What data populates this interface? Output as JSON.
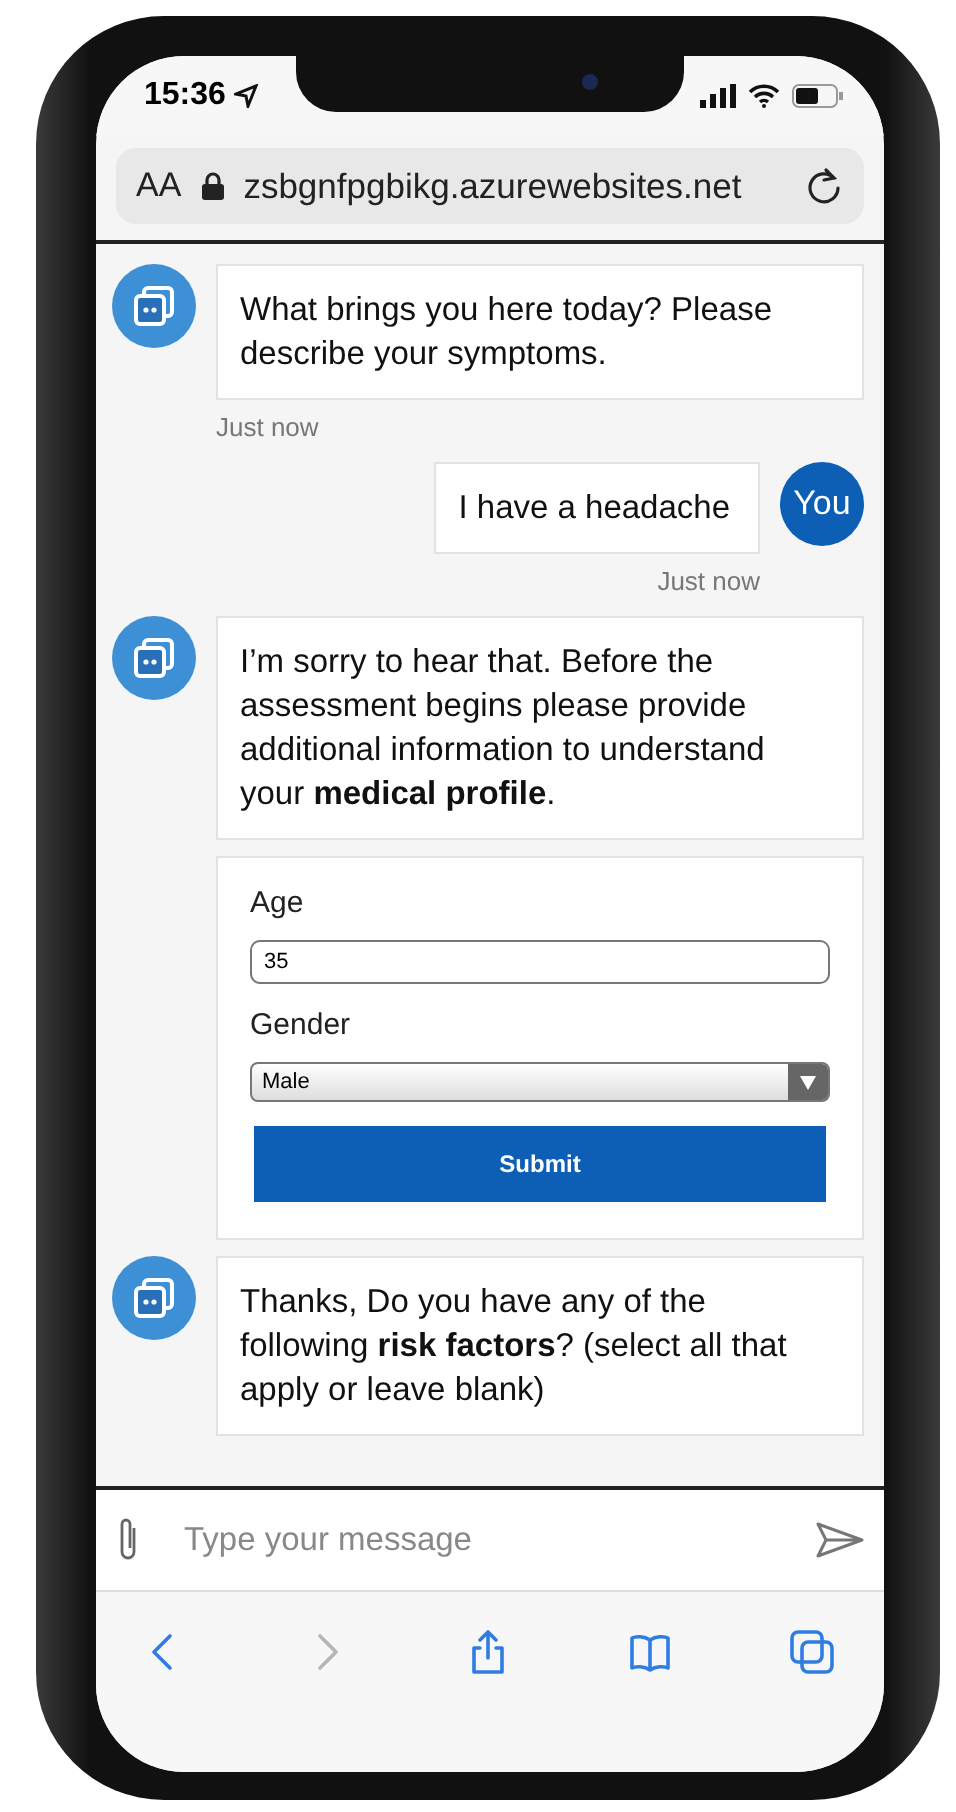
{
  "status_bar": {
    "time": "15:36"
  },
  "address_bar": {
    "text_size": "AA",
    "url": "zsbgnfpgbikg.azurewebsites.net"
  },
  "messages": [
    {
      "kind": "text",
      "from_user": false,
      "text": "What brings you here today? Please describe your symptoms.",
      "time": "Just now"
    },
    {
      "kind": "text",
      "from_user": true,
      "avatar": "You",
      "text": "I have a headache",
      "time": "Just now"
    },
    {
      "kind": "text",
      "from_user": false,
      "text": "I’m sorry to hear that. Before the assessment begins please provide additional information to understand your **medical profile**."
    },
    {
      "kind": "form",
      "from_user": false,
      "fields": [
        {
          "kind": "input",
          "label": "Age",
          "value": "35"
        },
        {
          "kind": "select",
          "label": "Gender",
          "value": "Male"
        }
      ],
      "submit": "Submit"
    },
    {
      "kind": "text",
      "from_user": false,
      "text": "Thanks, Do you have any of the following **risk factors**? (select all that apply or leave blank)"
    }
  ],
  "composer": {
    "placeholder": "Type your message"
  },
  "toolbar": [
    {
      "kind": "back",
      "disabled": false
    },
    {
      "kind": "forward",
      "disabled": true
    },
    {
      "kind": "share",
      "disabled": false
    },
    {
      "kind": "bookmarks",
      "disabled": false
    },
    {
      "kind": "tabs",
      "disabled": false
    }
  ]
}
